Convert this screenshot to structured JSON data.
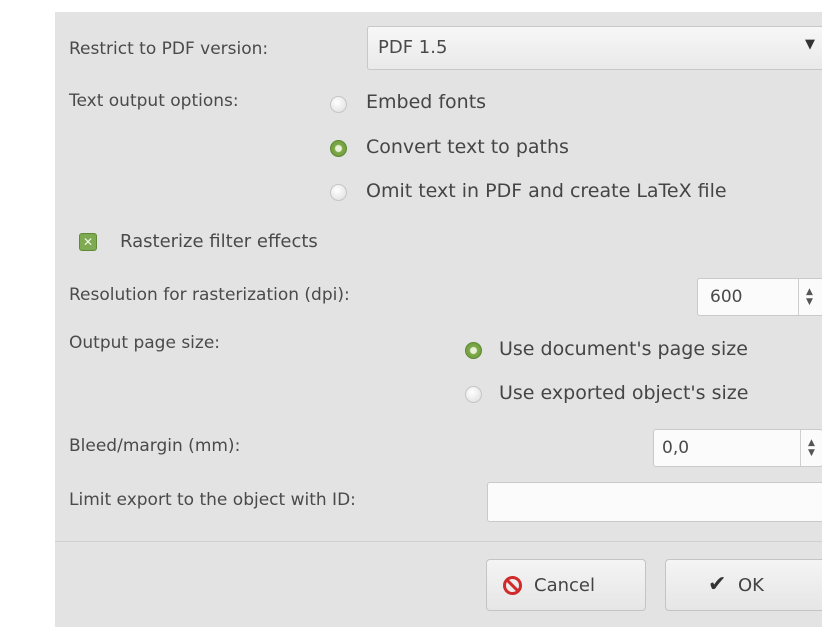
{
  "pdf_version": {
    "label": "Restrict to PDF version:",
    "selected": "PDF 1.5",
    "arrow_icon": "dropdown-arrow-icon"
  },
  "text_output": {
    "label": "Text output options:",
    "options": [
      {
        "label": "Embed fonts",
        "selected": false
      },
      {
        "label": "Convert text to paths",
        "selected": true
      },
      {
        "label": "Omit text in PDF and create LaTeX file",
        "selected": false
      }
    ]
  },
  "rasterize": {
    "label": "Rasterize filter effects",
    "checked": true
  },
  "resolution": {
    "label": "Resolution for rasterization (dpi):",
    "value": "600"
  },
  "page_size": {
    "label": "Output page size:",
    "options": [
      {
        "label": "Use document's page size",
        "selected": true
      },
      {
        "label": "Use exported object's size",
        "selected": false
      }
    ]
  },
  "bleed": {
    "label": "Bleed/margin (mm):",
    "value": "0,0"
  },
  "limit_export": {
    "label": "Limit export to the object with ID:",
    "value": ""
  },
  "buttons": {
    "cancel": "Cancel",
    "ok": "OK"
  },
  "colors": {
    "dialog_bg": "#e3e3e3",
    "accent_green": "#7da849",
    "cancel_red": "#d02a2a"
  }
}
